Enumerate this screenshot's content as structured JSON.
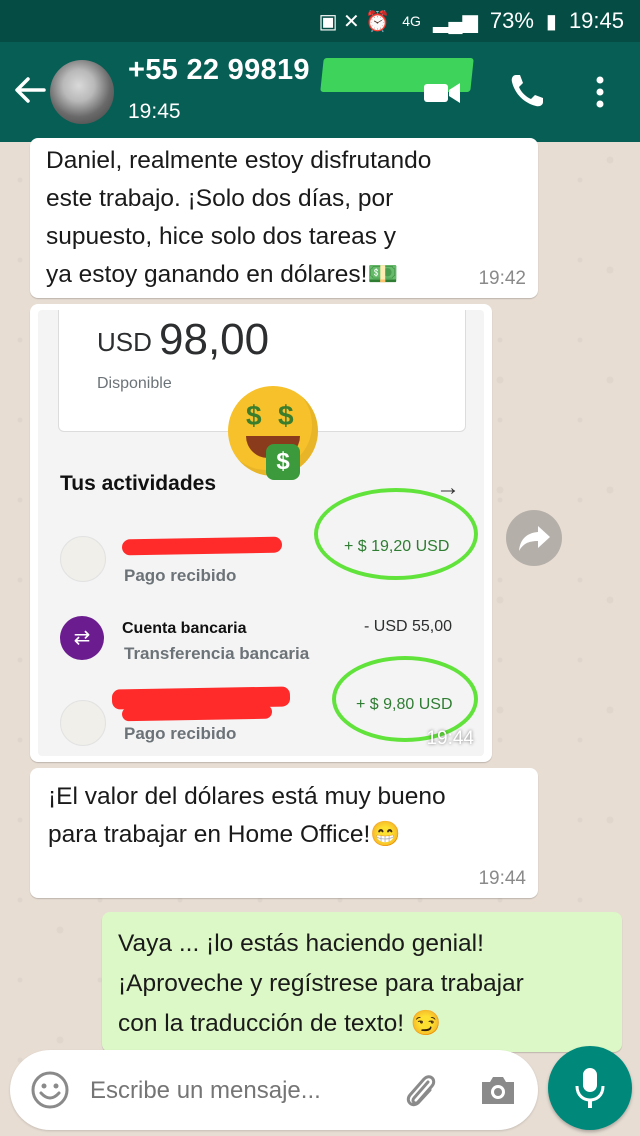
{
  "status_bar": {
    "network": "4G",
    "battery": "73%",
    "time": "19:45"
  },
  "header": {
    "contact_name": "+55 22 99819",
    "contact_status": "19:45"
  },
  "messages": [
    {
      "direction": "in",
      "text": "Daniel, realmente estoy disfrutando\neste trabajo. ¡Solo dos días, por\nsupuesto, hice solo dos tareas y\nya estoy ganando en dólares!💵",
      "time": "19:42"
    },
    {
      "direction": "in",
      "type": "image",
      "time": "19:44",
      "image": {
        "currency": "USD",
        "balance": "98,00",
        "balance_label": "Disponible",
        "activities_title": "Tus actividades",
        "rows": [
          {
            "title": "",
            "subtitle": "Pago recibido",
            "amount": "+ $ 19,20 USD"
          },
          {
            "title": "Cuenta bancaria",
            "subtitle": "Transferencia bancaria",
            "amount": "- USD 55,00"
          },
          {
            "title": "",
            "subtitle": "Pago recibido",
            "amount": "+ $ 9,80 USD"
          }
        ]
      }
    },
    {
      "direction": "in",
      "text": "¡El valor del dólares está muy bueno\npara trabajar en Home Office!😁",
      "time": "19:44"
    },
    {
      "direction": "out",
      "text": "Vaya ... ¡lo estás haciendo genial!\n¡Aproveche y regístrese para trabajar\ncon la traducción de texto! 😏"
    }
  ],
  "input": {
    "placeholder": "Escribe un mensaje..."
  },
  "colors": {
    "header": "#075e54",
    "status_bar": "#054d44",
    "outgoing_bubble": "#dcf8c6",
    "accent": "#00897b"
  }
}
